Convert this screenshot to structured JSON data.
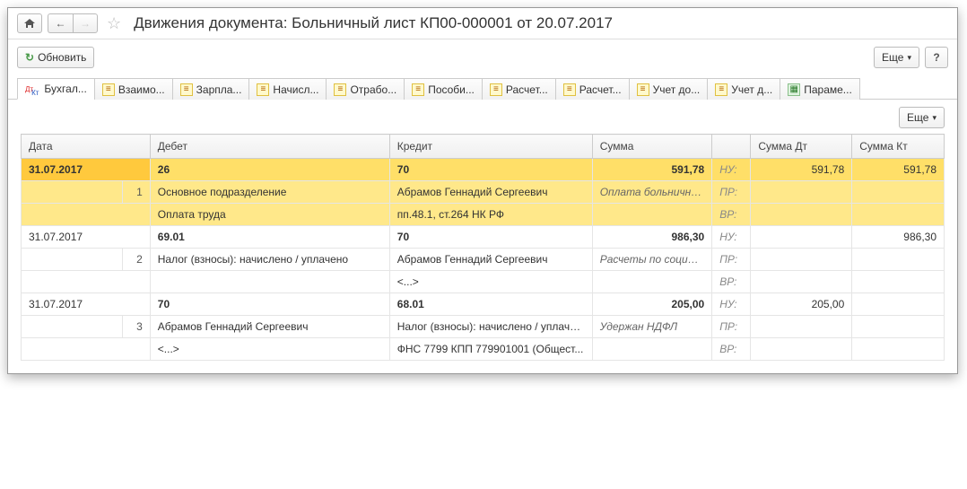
{
  "title": "Движения документа: Больничный лист КП00-000001 от 20.07.2017",
  "toolbar": {
    "refresh": "Обновить",
    "more": "Еще",
    "help": "?"
  },
  "tabs": [
    {
      "label": "Бухгал...",
      "icon": "dtkt",
      "active": true
    },
    {
      "label": "Взаимо...",
      "icon": "reg"
    },
    {
      "label": "Зарпла...",
      "icon": "reg"
    },
    {
      "label": "Начисл...",
      "icon": "reg"
    },
    {
      "label": "Отрабо...",
      "icon": "reg"
    },
    {
      "label": "Пособи...",
      "icon": "reg"
    },
    {
      "label": "Расчет...",
      "icon": "reg"
    },
    {
      "label": "Расчет...",
      "icon": "reg"
    },
    {
      "label": "Учет до...",
      "icon": "reg"
    },
    {
      "label": "Учет д...",
      "icon": "reg"
    },
    {
      "label": "Параме...",
      "icon": "table"
    }
  ],
  "columns": {
    "date": "Дата",
    "debit": "Дебет",
    "credit": "Кредит",
    "sum": "Сумма",
    "sum_dt": "Сумма Дт",
    "sum_kt": "Сумма Кт"
  },
  "flags": {
    "nu": "НУ:",
    "pr": "ПР:",
    "vr": "ВР:"
  },
  "entries": [
    {
      "highlight": true,
      "date": "31.07.2017",
      "num": "1",
      "debit_acc": "26",
      "credit_acc": "70",
      "sum": "591,78",
      "sum_dt": "591,78",
      "sum_kt": "591,78",
      "debit_l1": "Основное подразделение",
      "credit_l1": "Абрамов Геннадий Сергеевич",
      "desc": "Оплата больничного з...",
      "debit_l2": "Оплата труда",
      "credit_l2": "пп.48.1, ст.264 НК РФ"
    },
    {
      "highlight": false,
      "date": "31.07.2017",
      "num": "2",
      "debit_acc": "69.01",
      "credit_acc": "70",
      "sum": "986,30",
      "sum_dt": "",
      "sum_kt": "986,30",
      "debit_l1": "Налог (взносы): начислено / уплачено",
      "credit_l1": "Абрамов Геннадий Сергеевич",
      "desc": "Расчеты по социальному ...",
      "debit_l2": "",
      "credit_l2": "<...>"
    },
    {
      "highlight": false,
      "date": "31.07.2017",
      "num": "3",
      "debit_acc": "70",
      "credit_acc": "68.01",
      "sum": "205,00",
      "sum_dt": "205,00",
      "sum_kt": "",
      "debit_l1": "Абрамов Геннадий Сергеевич",
      "credit_l1": "Налог (взносы): начислено / уплаче...",
      "desc": "Удержан НДФЛ",
      "debit_l2": "<...>",
      "credit_l2": "ФНС 7799 КПП 779901001 (Общест..."
    }
  ]
}
